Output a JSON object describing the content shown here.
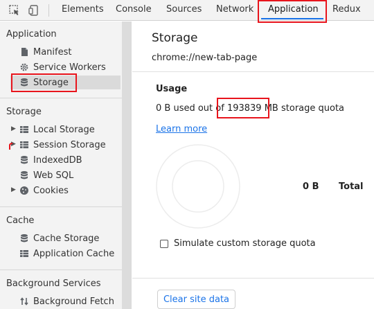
{
  "toolbar": {
    "tabs": [
      {
        "label": "Elements"
      },
      {
        "label": "Console"
      },
      {
        "label": "Sources"
      },
      {
        "label": "Network"
      },
      {
        "label": "Application"
      },
      {
        "label": "Redux"
      }
    ],
    "active_tab": "Application",
    "icons": [
      "inspect-element-icon",
      "device-toolbar-icon"
    ]
  },
  "sidebar": {
    "sections": [
      {
        "title": "Application",
        "items": [
          {
            "label": "Manifest",
            "icon": "manifest-icon"
          },
          {
            "label": "Service Workers",
            "icon": "gear-icon"
          },
          {
            "label": "Storage",
            "icon": "database-icon",
            "selected": true
          }
        ]
      },
      {
        "title": "Storage",
        "items": [
          {
            "label": "Local Storage",
            "icon": "grid-icon",
            "expandable": true
          },
          {
            "label": "Session Storage",
            "icon": "grid-icon",
            "expandable": true
          },
          {
            "label": "IndexedDB",
            "icon": "database-icon"
          },
          {
            "label": "Web SQL",
            "icon": "database-icon"
          },
          {
            "label": "Cookies",
            "icon": "cookie-icon",
            "expandable": true
          }
        ]
      },
      {
        "title": "Cache",
        "items": [
          {
            "label": "Cache Storage",
            "icon": "database-icon"
          },
          {
            "label": "Application Cache",
            "icon": "grid-icon"
          }
        ]
      },
      {
        "title": "Background Services",
        "items": [
          {
            "label": "Background Fetch",
            "icon": "sync-arrows-icon"
          }
        ]
      }
    ]
  },
  "main": {
    "title": "Storage",
    "url": "chrome://new-tab-page",
    "usage": {
      "heading": "Usage",
      "prefix": "0 B used out of",
      "quota": "193839 MB",
      "suffix": "storage quota",
      "learn_more": "Learn more",
      "used_value": "0 B",
      "total_label": "Total"
    },
    "simulate_label": "Simulate custom storage quota",
    "simulate_checked": false,
    "clear_button": "Clear site data"
  },
  "colors": {
    "accent": "#1a73e8",
    "highlight": "#e8141c",
    "sidebar_bg": "#f3f3f3",
    "selected_bg": "#dadada"
  }
}
